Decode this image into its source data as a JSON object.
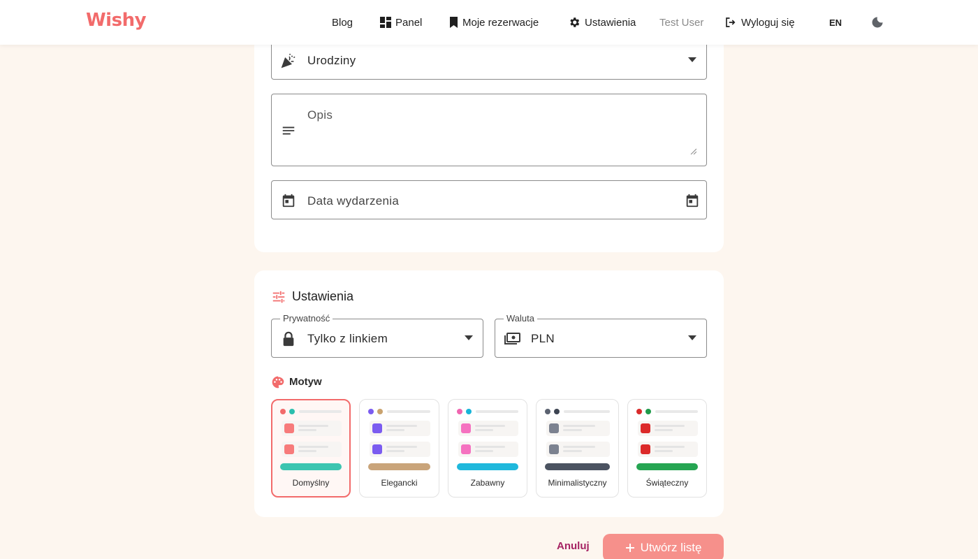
{
  "nav": {
    "logo": "Wishy",
    "blog": "Blog",
    "panel": "Panel",
    "reservations": "Moje rezerwacje",
    "settings": "Ustawienia",
    "user": "Test User",
    "logout": "Wyloguj się",
    "lang": "EN"
  },
  "form": {
    "occasion": {
      "value": "Urodziny"
    },
    "description": {
      "placeholder": "Opis"
    },
    "event_date": {
      "placeholder": "Data wydarzenia"
    }
  },
  "settings": {
    "title": "Ustawienia",
    "privacy": {
      "label": "Prywatność",
      "value": "Tylko z linkiem"
    },
    "currency": {
      "label": "Waluta",
      "value": "PLN"
    },
    "theme_title": "Motyw",
    "themes": [
      {
        "name": "Domyślny",
        "selected": true,
        "dot1": "#f26b6b",
        "dot2": "#2bbfae",
        "square": "#f77b7b",
        "accent": "#3cc5b0"
      },
      {
        "name": "Elegancki",
        "selected": false,
        "dot1": "#7b5cf0",
        "dot2": "#c9a26e",
        "square": "#7b5cf0",
        "accent": "#c9a47a"
      },
      {
        "name": "Zabawny",
        "selected": false,
        "dot1": "#f065b0",
        "dot2": "#18b4d8",
        "square": "#f572c0",
        "accent": "#1fb8dc"
      },
      {
        "name": "Minimalistyczny",
        "selected": false,
        "dot1": "#5b6270",
        "dot2": "#3d4452",
        "square": "#7c8290",
        "accent": "#4b5361"
      },
      {
        "name": "Świąteczny",
        "selected": false,
        "dot1": "#d92b2b",
        "dot2": "#1f9a4a",
        "square": "#dc2a2a",
        "accent": "#26a552"
      }
    ]
  },
  "actions": {
    "cancel": "Anuluj",
    "create": "Utwórz listę"
  },
  "colors": {
    "brand": "#f26b6b",
    "primary_button": "#f6908b",
    "cancel_text": "#a62363",
    "page_bg": "#fdf6ef"
  }
}
